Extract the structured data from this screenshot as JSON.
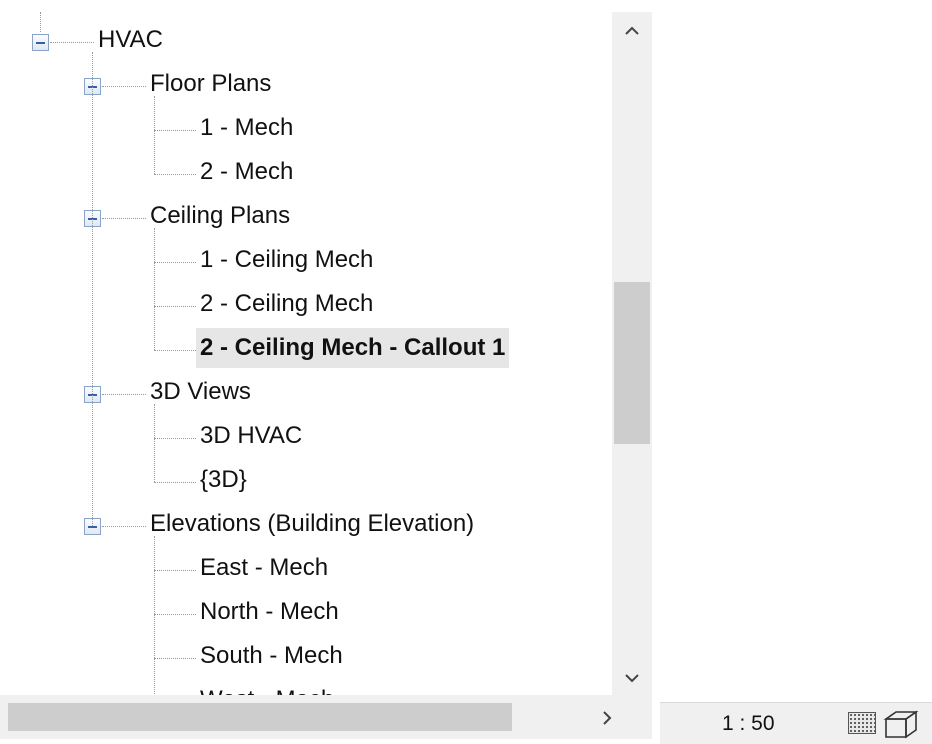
{
  "tree": {
    "nodes": [
      {
        "label": "HVAC",
        "level": 0,
        "expanded": true
      },
      {
        "label": "Floor Plans",
        "level": 1,
        "expanded": true
      },
      {
        "label": "1 - Mech",
        "level": 2
      },
      {
        "label": "2 - Mech",
        "level": 2
      },
      {
        "label": "Ceiling Plans",
        "level": 1,
        "expanded": true
      },
      {
        "label": "1 - Ceiling Mech",
        "level": 2
      },
      {
        "label": "2 - Ceiling Mech",
        "level": 2
      },
      {
        "label": "2 - Ceiling Mech - Callout 1",
        "level": 2,
        "selected": true
      },
      {
        "label": "3D Views",
        "level": 1,
        "expanded": true
      },
      {
        "label": "3D HVAC",
        "level": 2
      },
      {
        "label": "{3D}",
        "level": 2
      },
      {
        "label": "Elevations (Building Elevation)",
        "level": 1,
        "expanded": true
      },
      {
        "label": "East - Mech",
        "level": 2
      },
      {
        "label": "North - Mech",
        "level": 2
      },
      {
        "label": "South - Mech",
        "level": 2
      },
      {
        "label": "West - Mech",
        "level": 2
      }
    ]
  },
  "scrollbar": {
    "up": "^",
    "down": "v",
    "right": ">"
  },
  "status": {
    "scale": "1 : 50"
  },
  "icons": {
    "detail_level": "detail-level-icon",
    "visual_style": "visual-style-cube-icon"
  }
}
